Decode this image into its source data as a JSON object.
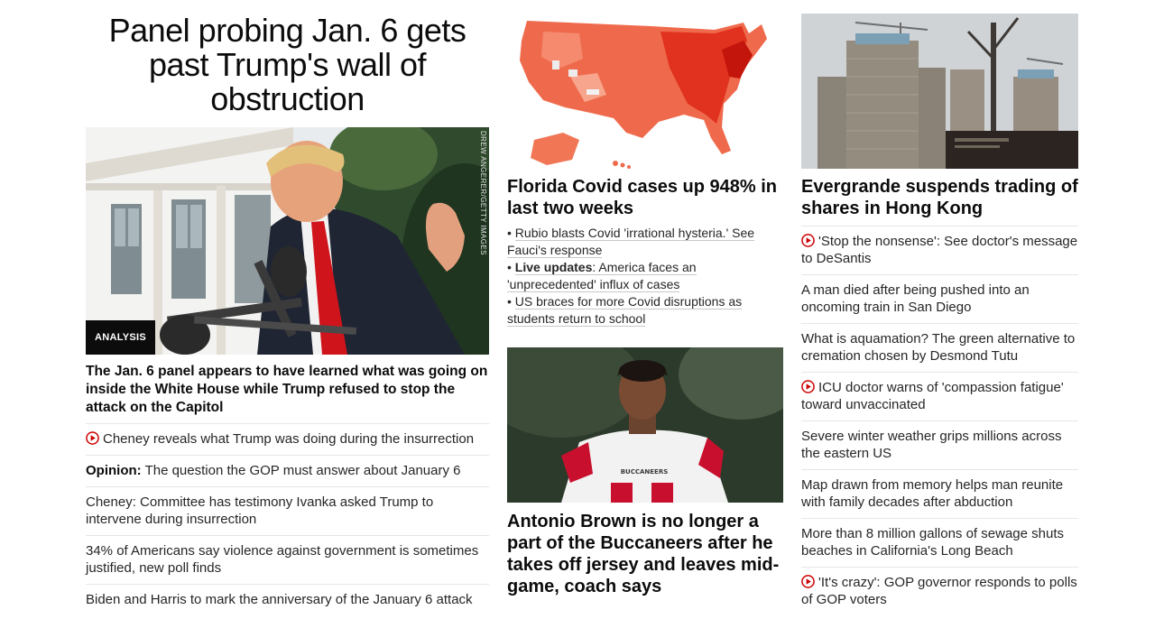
{
  "left": {
    "headline": "Panel probing Jan. 6 gets past Trump's wall of obstruction",
    "badge": "ANALYSIS",
    "photo_credit": "DREW ANGERER/GETTY IMAGES",
    "description": "The Jan. 6 panel appears to have learned what was going on inside the White House while Trump refused to stop the attack on the Capitol",
    "links": [
      {
        "video": true,
        "prefix": "",
        "text": "Cheney reveals what Trump was doing during the insurrection"
      },
      {
        "video": false,
        "prefix": "Opinion:",
        "text": "The question the GOP must answer about January 6"
      },
      {
        "video": false,
        "prefix": "",
        "text": "Cheney: Committee has testimony Ivanka asked Trump to intervene during insurrection"
      },
      {
        "video": false,
        "prefix": "",
        "text": "34% of Americans say violence against government is sometimes justified, new poll finds"
      },
      {
        "video": false,
        "prefix": "",
        "text": "Biden and Harris to mark the anniversary of the January 6 attack"
      }
    ]
  },
  "middle": {
    "story1": {
      "headline": "Florida Covid cases up 948% in last two weeks",
      "bullets": [
        {
          "prefix": "",
          "text": "Rubio blasts Covid 'irrational hysteria.' See Fauci's response"
        },
        {
          "prefix": "Live updates",
          "text": ": America faces an 'unprecedented' influx of cases"
        },
        {
          "prefix": "",
          "text": "US braces for more Covid disruptions as students return to school"
        }
      ]
    },
    "story2": {
      "headline": "Antonio Brown is no longer a part of the Buccaneers after he takes off jersey and leaves mid-game, coach says",
      "jersey_text": "BUCCANEERS"
    }
  },
  "right": {
    "headline": "Evergrande suspends trading of shares in Hong Kong",
    "links": [
      {
        "video": true,
        "text": "'Stop the nonsense': See doctor's message to DeSantis"
      },
      {
        "video": false,
        "text": "A man died after being pushed into an oncoming train in San Diego"
      },
      {
        "video": false,
        "text": "What is aquamation? The green alternative to cremation chosen by Desmond Tutu"
      },
      {
        "video": true,
        "text": "ICU doctor warns of 'compassion fatigue' toward unvaccinated"
      },
      {
        "video": false,
        "text": "Severe winter weather grips millions across the eastern US"
      },
      {
        "video": false,
        "text": "Map drawn from memory helps man reunite with family decades after abduction"
      },
      {
        "video": false,
        "text": "More than 8 million gallons of sewage shuts beaches in California's Long Beach"
      },
      {
        "video": true,
        "text": "'It's crazy': GOP governor responds to polls of GOP voters"
      }
    ]
  },
  "colors": {
    "accent_red": "#cc0000",
    "text": "#262626",
    "divider": "#e6e6e6"
  }
}
